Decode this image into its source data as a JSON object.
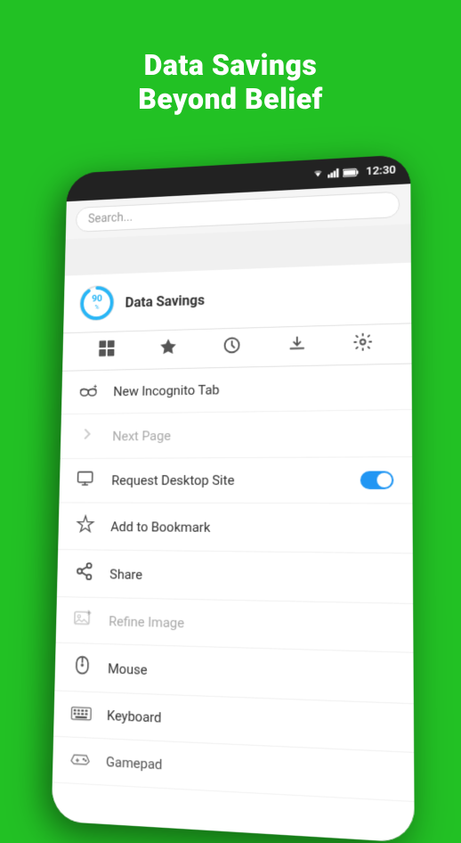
{
  "hero": {
    "line1": "Data Savings",
    "line2": "Beyond Belief"
  },
  "status_bar": {
    "time": "12:30",
    "wifi": "▼",
    "signal": "▲",
    "battery": "🔋"
  },
  "search_placeholder": "Search...",
  "data_savings": {
    "percent": "90",
    "percent_unit": "%",
    "label": "Data Savings"
  },
  "toolbar": {
    "icons": [
      "apps",
      "star",
      "clock",
      "download",
      "settings"
    ]
  },
  "menu_items": [
    {
      "id": "new-incognito-tab",
      "icon": "incognito",
      "label": "New Incognito Tab",
      "disabled": false,
      "toggle": false
    },
    {
      "id": "next-page",
      "icon": "chevron-right",
      "label": "Next Page",
      "disabled": true,
      "toggle": false
    },
    {
      "id": "request-desktop-site",
      "icon": "desktop",
      "label": "Request Desktop Site",
      "disabled": false,
      "toggle": true
    },
    {
      "id": "add-to-bookmark",
      "icon": "bookmark",
      "label": "Add to Bookmark",
      "disabled": false,
      "toggle": false
    },
    {
      "id": "share",
      "icon": "share",
      "label": "Share",
      "disabled": false,
      "toggle": false
    },
    {
      "id": "refine-image",
      "icon": "image",
      "label": "Refine Image",
      "disabled": true,
      "toggle": false
    },
    {
      "id": "mouse",
      "icon": "mouse",
      "label": "Mouse",
      "disabled": false,
      "toggle": false
    },
    {
      "id": "keyboard",
      "icon": "keyboard",
      "label": "Keyboard",
      "disabled": false,
      "toggle": false
    },
    {
      "id": "gamepad",
      "icon": "gamepad",
      "label": "Gamepad",
      "disabled": false,
      "toggle": false
    }
  ]
}
